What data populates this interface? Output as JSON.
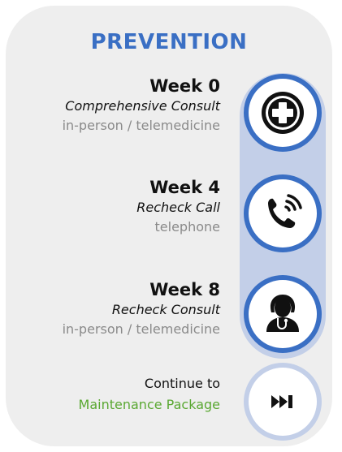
{
  "header": {
    "title": "PREVENTION"
  },
  "steps": [
    {
      "week": "Week 0",
      "name": "Comprehensive Consult",
      "mode": "in-person / telemedicine",
      "icon": "medical-cross-icon"
    },
    {
      "week": "Week 4",
      "name": "Recheck Call",
      "mode": "telephone",
      "icon": "phone-call-icon"
    },
    {
      "week": "Week 8",
      "name": "Recheck Consult",
      "mode": "in-person / telemedicine",
      "icon": "doctor-icon"
    }
  ],
  "continue": {
    "text": "Continue to",
    "link": "Maintenance Package",
    "icon": "skip-forward-icon"
  },
  "colors": {
    "accent": "#3a6fc4",
    "track": "#c3cfe8",
    "card": "#eeeeee",
    "link": "#5aa832",
    "muted": "#8a8a8a"
  }
}
